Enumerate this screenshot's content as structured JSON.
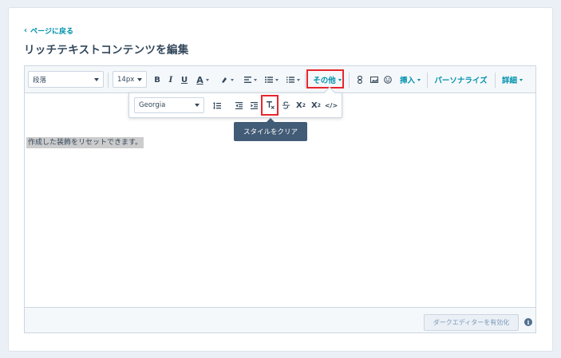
{
  "nav": {
    "back_label": "ページに戻る"
  },
  "page": {
    "title": "リッチテキストコンテンツを編集"
  },
  "toolbar": {
    "paragraph_select": "段落",
    "font_size_select": "14px",
    "bold": "B",
    "italic": "I",
    "underline": "U",
    "text_color": "A",
    "more_label": "その他",
    "insert_label": "挿入",
    "personalize_label": "パーソナライズ",
    "advanced_label": "詳細"
  },
  "popover": {
    "font_select": "Georgia",
    "superscript": "X",
    "subscript": "X",
    "code_label": "</>"
  },
  "tooltip": {
    "text": "スタイルをクリア"
  },
  "content": {
    "text": "作成した装飾をリセットできます。"
  },
  "footer": {
    "dark_editor_button": "ダークエディターを有効化",
    "info_glyph": "i"
  },
  "colors": {
    "accent": "#0091ae",
    "highlight": "#e8262b",
    "tooltip_bg": "#425b76"
  }
}
